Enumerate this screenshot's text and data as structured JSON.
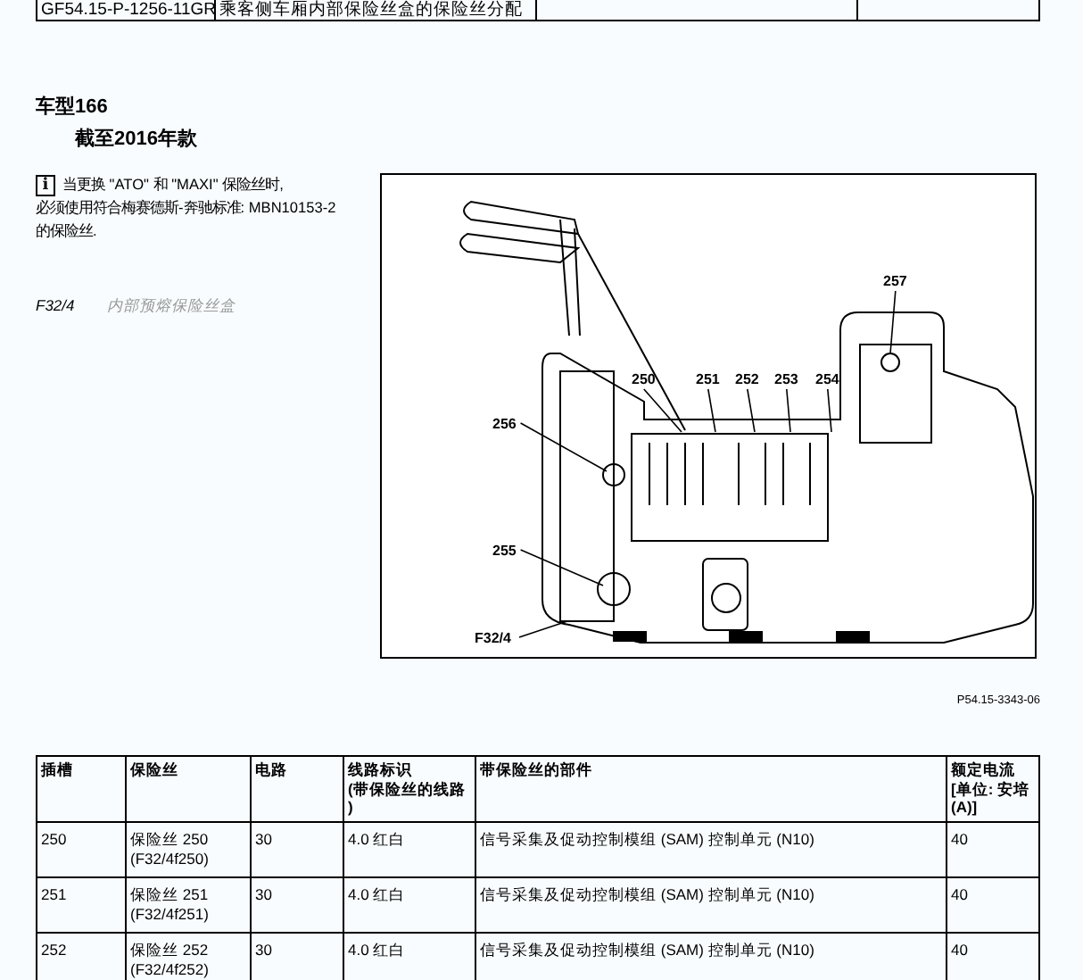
{
  "header_row": {
    "code": "GF54.15-P-1256-11GR",
    "title": "乘客侧车厢内部保险丝盒的保险丝分配"
  },
  "model": {
    "title": "车型166",
    "subtitle": "截至2016年款"
  },
  "note": {
    "icon": "i",
    "lines": [
      "当更换 \"ATO\" 和 \"MAXI\" 保险丝时,",
      "必须使用符合梅赛德斯-奔驰标准: MBN10153-2",
      "的保险丝."
    ]
  },
  "component": {
    "code": "F32/4",
    "name": "内部预熔保险丝盒"
  },
  "figure": {
    "callouts": [
      "257",
      "250",
      "251",
      "252",
      "253",
      "254",
      "256",
      "255",
      "F32/4"
    ],
    "code": "P54.15-3343-06"
  },
  "table": {
    "columns": [
      "插槽",
      "保险丝",
      "电路",
      "线路标识\n(带保险丝的线路\n)",
      "带保险丝的部件",
      "额定电流\n[单位: 安培\n(A)]"
    ],
    "rows": [
      [
        "250",
        "保险丝 250\n(F32/4f250)",
        "30",
        "4.0 红白",
        "信号采集及促动控制模组 (SAM) 控制单元 (N10)",
        "40"
      ],
      [
        "251",
        "保险丝 251\n(F32/4f251)",
        "30",
        "4.0 红白",
        "信号采集及促动控制模组 (SAM) 控制单元 (N10)",
        "40"
      ],
      [
        "252",
        "保险丝 252\n(F32/4f252)",
        "30",
        "4.0 红白",
        "信号采集及促动控制模组 (SAM) 控制单元 (N10)",
        "40"
      ]
    ]
  }
}
